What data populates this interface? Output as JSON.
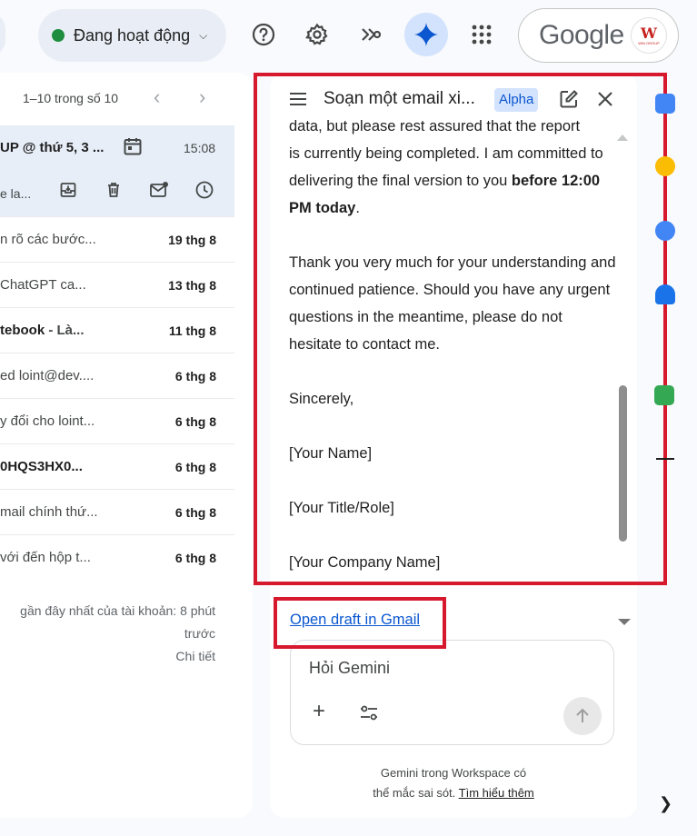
{
  "topbar": {
    "status_label": "Đang hoạt động",
    "status_color": "#1e8e3e",
    "icons": [
      "help-icon",
      "settings-icon",
      "apps-script-icon",
      "gemini-icon",
      "apps-grid-icon"
    ],
    "account_brand": "Google",
    "avatar_label": "WIN GROUP"
  },
  "mail_list": {
    "pager": "1–10 trong số 10",
    "hover_row": {
      "title": "UP @ thứ 5, 3 ...",
      "time": "15:08",
      "snippet": "e la..."
    },
    "rows": [
      {
        "snippet": "n rõ các bước...",
        "date": "19 thg 8",
        "bold": false
      },
      {
        "snippet": "ChatGPT ca...",
        "date": "13 thg 8",
        "bold": false
      },
      {
        "snippet": "tebook",
        "suffix": " - Là...",
        "date": "11 thg 8",
        "bold": true
      },
      {
        "snippet": "ed loint@dev....",
        "date": "6 thg 8",
        "bold": false
      },
      {
        "snippet": "y đổi cho loint...",
        "date": "6 thg 8",
        "bold": false
      },
      {
        "snippet": "0HQS3HX0...",
        "date": "6 thg 8",
        "bold": true
      },
      {
        "snippet": "mail chính thứ...",
        "date": "6 thg 8",
        "bold": false
      },
      {
        "snippet": "với đến hộp t...",
        "date": "6 thg 8",
        "bold": false
      }
    ],
    "activity_line1": "gần đây nhất của tài khoản: 8 phút",
    "activity_line2": "trước",
    "activity_link": "Chi tiết"
  },
  "gemini": {
    "title": "Soạn một email xi...",
    "badge": "Alpha",
    "body": {
      "line_top": "data, but please rest assured that the report",
      "p1_start": "is currently being completed. I am committed to delivering the final version to you ",
      "p1_bold": "before 12:00 PM today",
      "p1_end": ".",
      "p2": "Thank you very much for your understanding and continued patience. Should you have any urgent questions in the meantime, please do not hesitate to contact me.",
      "p3": "Sincerely,",
      "p4": "[Your Name]",
      "p5": "[Your Title/Role]",
      "p6": "[Your Company Name]"
    },
    "open_draft": "Open draft in Gmail",
    "ask_placeholder": "Hỏi Gemini",
    "disclaimer_line1": "Gemini trong Workspace có",
    "disclaimer_line2": "thể mắc sai sót.",
    "learn_more": "Tìm hiểu thêm"
  },
  "colors": {
    "annotation_red": "#d7192e",
    "link_blue": "#0b57d0",
    "badge_bg": "#d3e3fd"
  }
}
